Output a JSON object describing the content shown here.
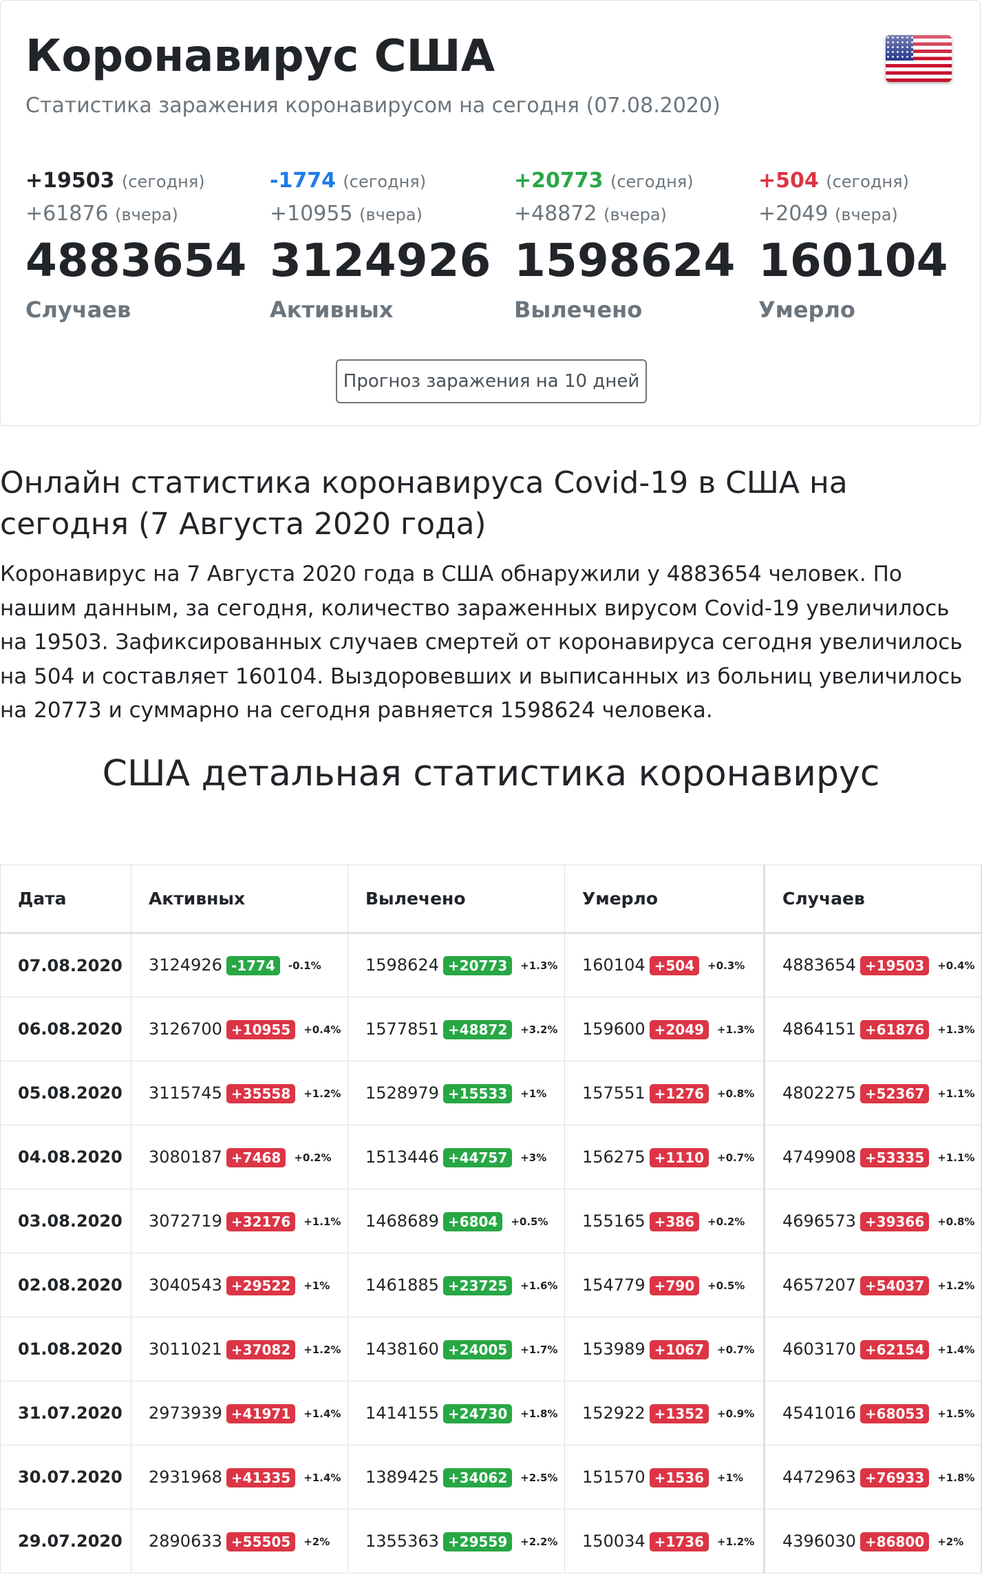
{
  "colors": {
    "positive": "#28a745",
    "negative": "#dc3545",
    "info": "#1e7ce8"
  },
  "header": {
    "title": "Коронавирус США",
    "subtitle": "Статистика заражения коронавирусом на сегодня (07.08.2020)",
    "flag_icon": "us-flag-icon"
  },
  "stats": [
    {
      "today": "+19503",
      "today_label": "(сегодня)",
      "yesterday": "+61876",
      "yesterday_label": "(вчера)",
      "total": "4883654",
      "name": "Случаев",
      "color": "#212529"
    },
    {
      "today": "-1774",
      "today_label": "(сегодня)",
      "yesterday": "+10955",
      "yesterday_label": "(вчера)",
      "total": "3124926",
      "name": "Активных",
      "color": "#1e7ce8"
    },
    {
      "today": "+20773",
      "today_label": "(сегодня)",
      "yesterday": "+48872",
      "yesterday_label": "(вчера)",
      "total": "1598624",
      "name": "Вылечено",
      "color": "#28a745"
    },
    {
      "today": "+504",
      "today_label": "(сегодня)",
      "yesterday": "+2049",
      "yesterday_label": "(вчера)",
      "total": "160104",
      "name": "Умерло",
      "color": "#dc3545"
    }
  ],
  "forecast_button": "Прогноз заражения на 10 дней",
  "article": {
    "heading": "Онлайн статистика коронавируса Covid-19 в США на сегодня (7 Августа 2020 года)",
    "paragraph": "Коронавирус на 7 Августа 2020 года в США обнаружили у 4883654 человек. По нашим данным, за сегодня, количество зараженных вирусом Covid-19 увеличилось на 19503. Зафиксированных случаев смертей от коронавируса сегодня увеличилось на 504 и составляет 160104. Выздоровевших и выписанных из больниц увеличилось на 20773 и суммарно на сегодня равняется 1598624 человека."
  },
  "table": {
    "heading": "США детальная статистика коронавирус",
    "columns": [
      "Дата",
      "Активных",
      "Вылечено",
      "Умерло",
      "Случаев"
    ],
    "rows": [
      {
        "date": "07.08.2020",
        "active": [
          "3124926",
          "-1774",
          "-0.1%"
        ],
        "recovered": [
          "1598624",
          "+20773",
          "+1.3%"
        ],
        "deaths": [
          "160104",
          "+504",
          "+0.3%"
        ],
        "cases": [
          "4883654",
          "+19503",
          "+0.4%"
        ]
      },
      {
        "date": "06.08.2020",
        "active": [
          "3126700",
          "+10955",
          "+0.4%"
        ],
        "recovered": [
          "1577851",
          "+48872",
          "+3.2%"
        ],
        "deaths": [
          "159600",
          "+2049",
          "+1.3%"
        ],
        "cases": [
          "4864151",
          "+61876",
          "+1.3%"
        ]
      },
      {
        "date": "05.08.2020",
        "active": [
          "3115745",
          "+35558",
          "+1.2%"
        ],
        "recovered": [
          "1528979",
          "+15533",
          "+1%"
        ],
        "deaths": [
          "157551",
          "+1276",
          "+0.8%"
        ],
        "cases": [
          "4802275",
          "+52367",
          "+1.1%"
        ]
      },
      {
        "date": "04.08.2020",
        "active": [
          "3080187",
          "+7468",
          "+0.2%"
        ],
        "recovered": [
          "1513446",
          "+44757",
          "+3%"
        ],
        "deaths": [
          "156275",
          "+1110",
          "+0.7%"
        ],
        "cases": [
          "4749908",
          "+53335",
          "+1.1%"
        ]
      },
      {
        "date": "03.08.2020",
        "active": [
          "3072719",
          "+32176",
          "+1.1%"
        ],
        "recovered": [
          "1468689",
          "+6804",
          "+0.5%"
        ],
        "deaths": [
          "155165",
          "+386",
          "+0.2%"
        ],
        "cases": [
          "4696573",
          "+39366",
          "+0.8%"
        ]
      },
      {
        "date": "02.08.2020",
        "active": [
          "3040543",
          "+29522",
          "+1%"
        ],
        "recovered": [
          "1461885",
          "+23725",
          "+1.6%"
        ],
        "deaths": [
          "154779",
          "+790",
          "+0.5%"
        ],
        "cases": [
          "4657207",
          "+54037",
          "+1.2%"
        ]
      },
      {
        "date": "01.08.2020",
        "active": [
          "3011021",
          "+37082",
          "+1.2%"
        ],
        "recovered": [
          "1438160",
          "+24005",
          "+1.7%"
        ],
        "deaths": [
          "153989",
          "+1067",
          "+0.7%"
        ],
        "cases": [
          "4603170",
          "+62154",
          "+1.4%"
        ]
      },
      {
        "date": "31.07.2020",
        "active": [
          "2973939",
          "+41971",
          "+1.4%"
        ],
        "recovered": [
          "1414155",
          "+24730",
          "+1.8%"
        ],
        "deaths": [
          "152922",
          "+1352",
          "+0.9%"
        ],
        "cases": [
          "4541016",
          "+68053",
          "+1.5%"
        ]
      },
      {
        "date": "30.07.2020",
        "active": [
          "2931968",
          "+41335",
          "+1.4%"
        ],
        "recovered": [
          "1389425",
          "+34062",
          "+2.5%"
        ],
        "deaths": [
          "151570",
          "+1536",
          "+1%"
        ],
        "cases": [
          "4472963",
          "+76933",
          "+1.8%"
        ]
      },
      {
        "date": "29.07.2020",
        "active": [
          "2890633",
          "+55505",
          "+2%"
        ],
        "recovered": [
          "1355363",
          "+29559",
          "+2.2%"
        ],
        "deaths": [
          "150034",
          "+1736",
          "+1.2%"
        ],
        "cases": [
          "4396030",
          "+86800",
          "+2%"
        ]
      }
    ]
  }
}
